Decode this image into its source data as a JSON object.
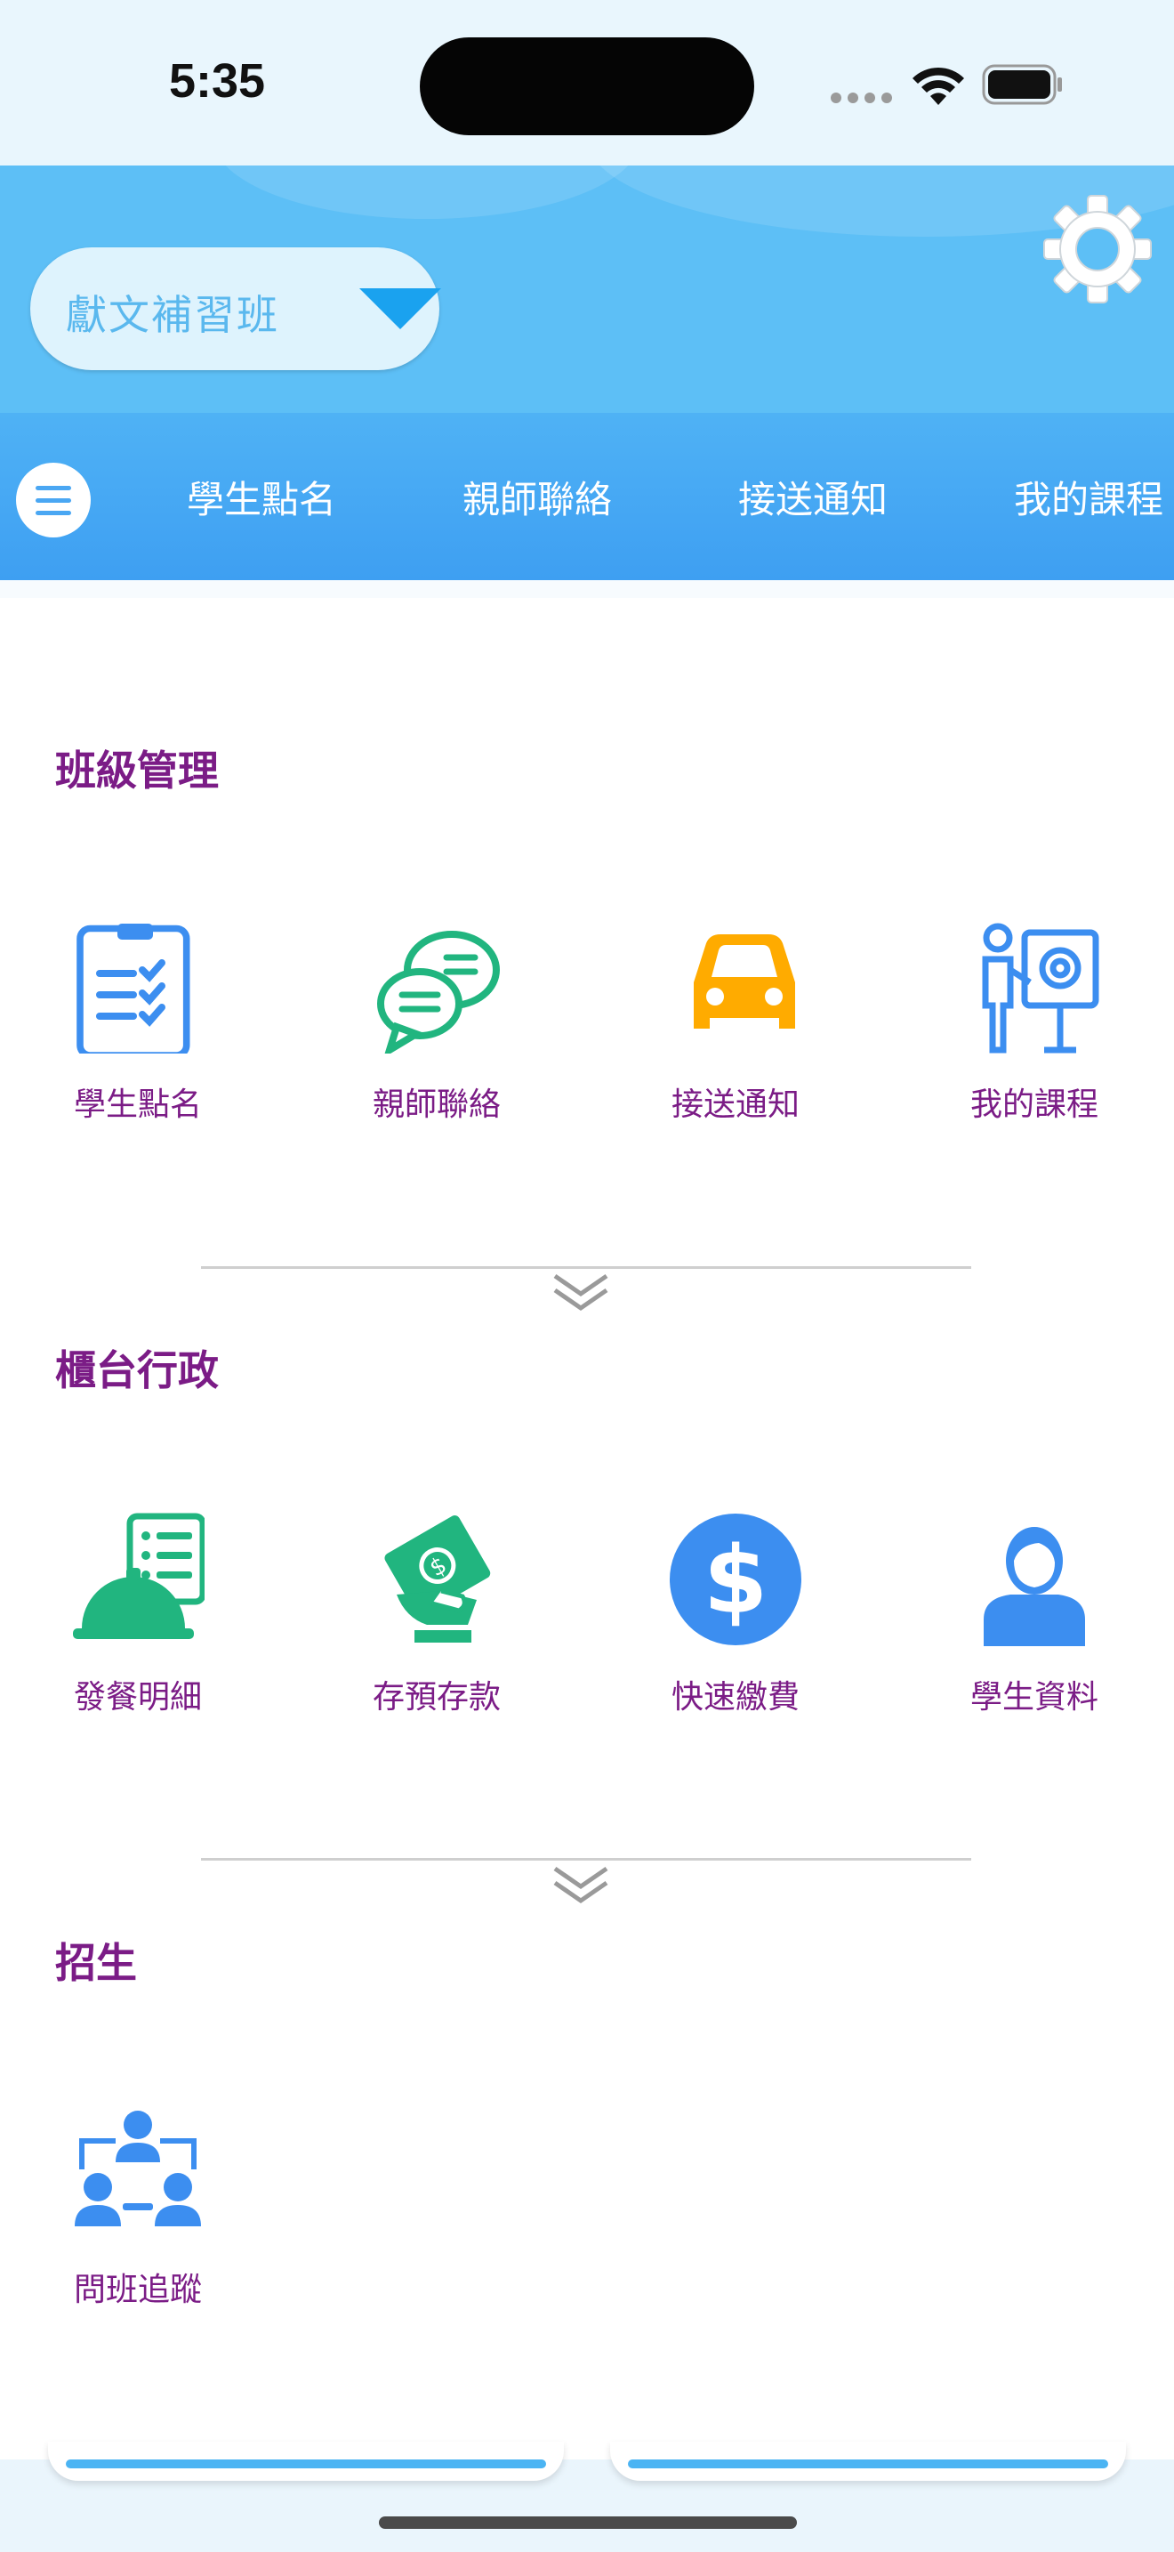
{
  "status_bar": {
    "time": "5:35"
  },
  "header": {
    "school_name": "獻文補習班"
  },
  "tabs": [
    "學生點名",
    "親師聯絡",
    "接送通知",
    "我的課程"
  ],
  "sections": [
    {
      "title": "班級管理",
      "items": [
        {
          "label": "學生點名",
          "icon": "clipboard-check-icon"
        },
        {
          "label": "親師聯絡",
          "icon": "chat-bubbles-icon"
        },
        {
          "label": "接送通知",
          "icon": "car-icon"
        },
        {
          "label": "我的課程",
          "icon": "teacher-board-icon"
        }
      ]
    },
    {
      "title": "櫃台行政",
      "items": [
        {
          "label": "發餐明細",
          "icon": "meal-cloche-icon"
        },
        {
          "label": "存預存款",
          "icon": "money-deposit-icon"
        },
        {
          "label": "快速繳費",
          "icon": "dollar-coin-icon"
        },
        {
          "label": "學生資料",
          "icon": "student-profile-icon"
        }
      ]
    },
    {
      "title": "招生",
      "items": [
        {
          "label": "問班追蹤",
          "icon": "org-chart-icon"
        }
      ]
    }
  ],
  "colors": {
    "header_blue": "#5dbff6",
    "tab_blue": "#4aa8f4",
    "section_title_purple": "#7b1c86",
    "icon_blue": "#3c8ef0",
    "icon_green": "#21b57f",
    "icon_orange": "#ffab00"
  }
}
